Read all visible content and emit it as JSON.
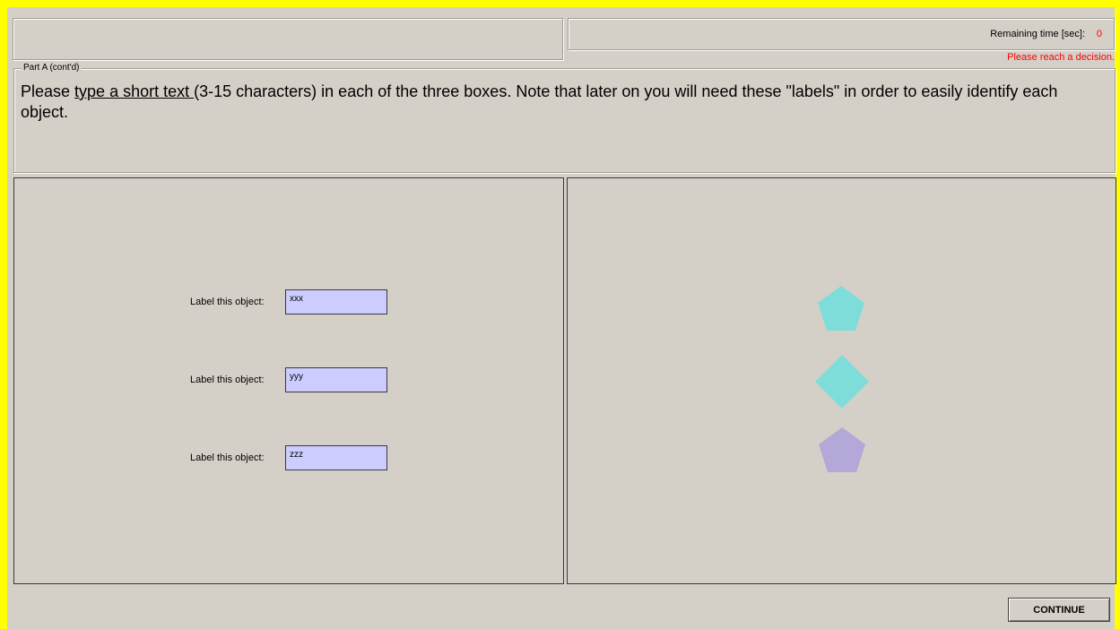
{
  "header": {
    "remaining_time_label": "Remaining time [sec]:",
    "remaining_time_value": "0",
    "decision_message": "Please reach a decision."
  },
  "partA": {
    "legend": "Part A (cont'd)",
    "instruction_before": "Please ",
    "instruction_underlined": "type a short text ",
    "instruction_after": "(3-15 characters) in each of the three boxes. Note that later on you will need these \"labels\" in order to easily identify each object."
  },
  "labels": [
    {
      "text": "Label this object:",
      "value": "xxx"
    },
    {
      "text": "Label this object:",
      "value": "yyy"
    },
    {
      "text": "Label this object:",
      "value": "zzz"
    }
  ],
  "objects": [
    {
      "shape": "pentagon",
      "color": "#7fddd9"
    },
    {
      "shape": "diamond",
      "color": "#7fddd9"
    },
    {
      "shape": "pentagon",
      "color": "#b3a8d7"
    }
  ],
  "colors": {
    "frame": "#ffff00",
    "background": "#d4d0c8",
    "input_background": "#ccccff",
    "alert": "#ff0000"
  },
  "buttons": {
    "continue_label": "CONTINUE"
  }
}
